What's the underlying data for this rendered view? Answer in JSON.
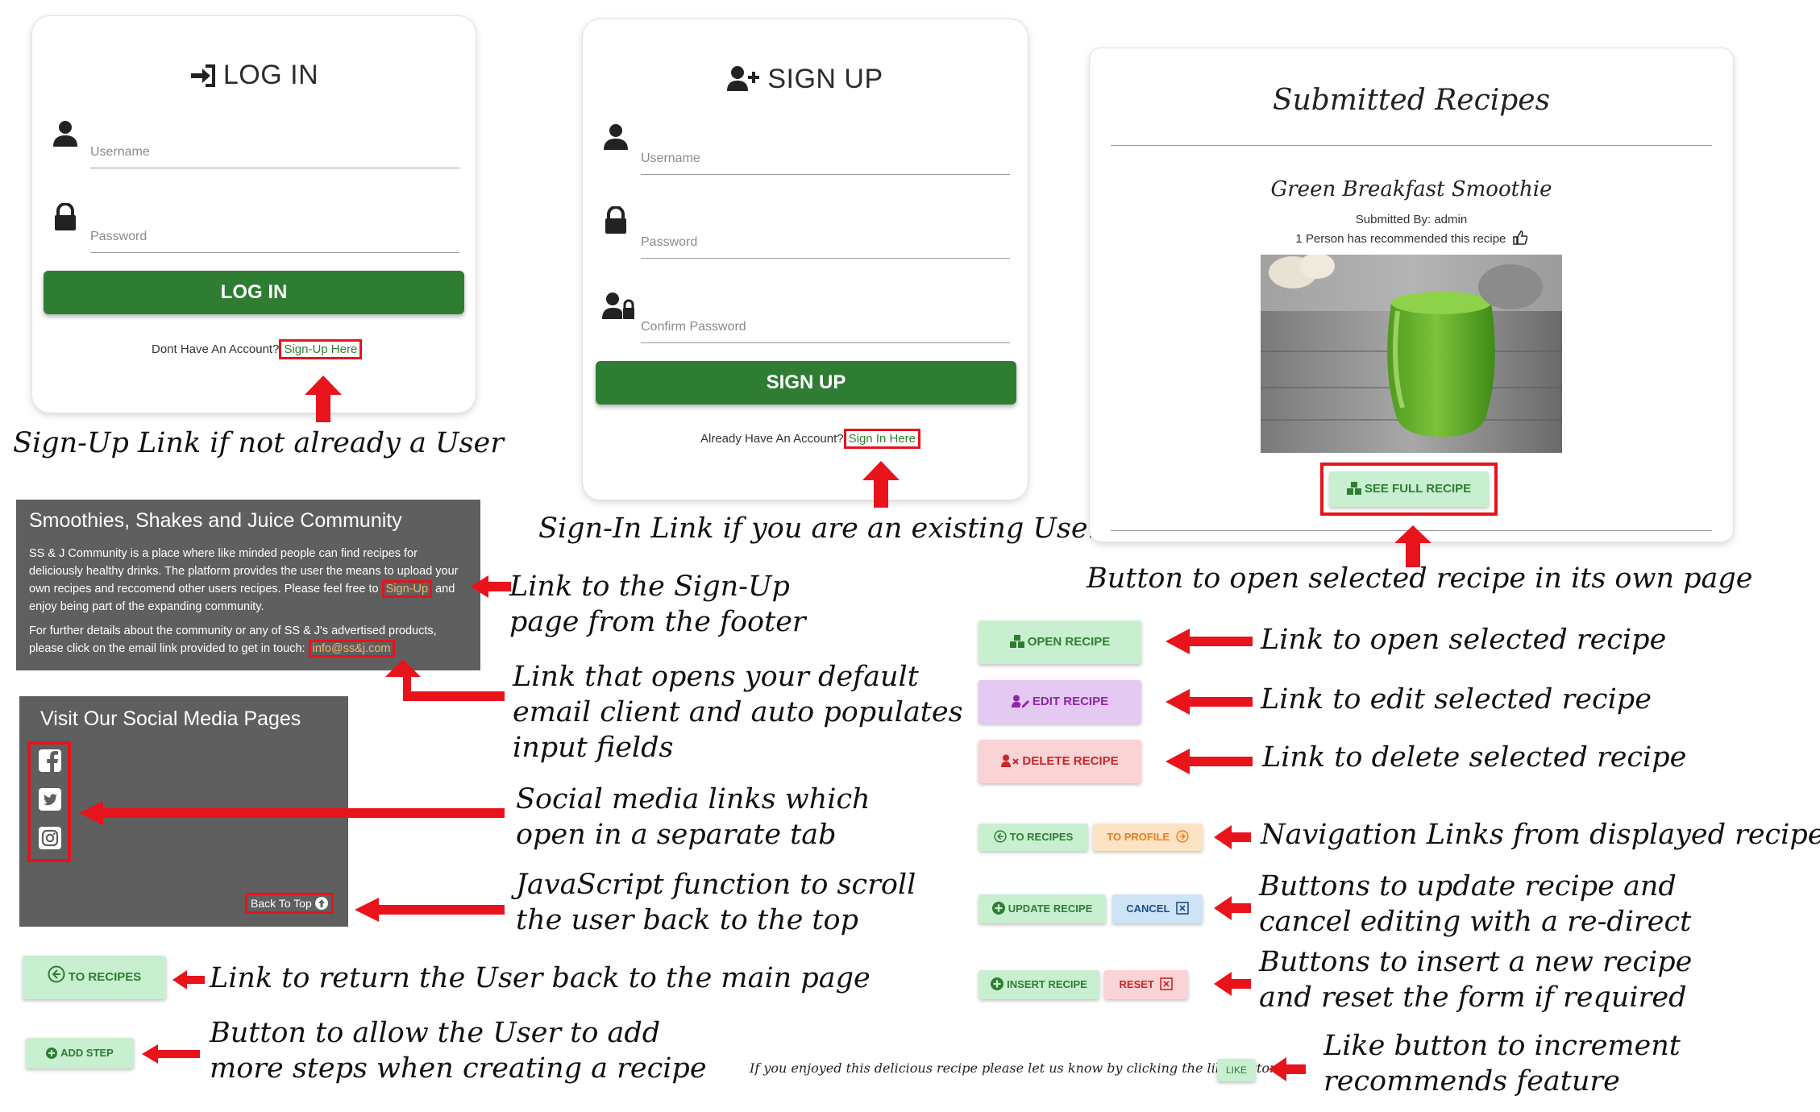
{
  "login": {
    "title": "LOG IN",
    "username_placeholder": "Username",
    "password_placeholder": "Password",
    "button": "LOG IN",
    "footer_text": "Dont Have An Account?",
    "footer_link": "Sign-Up Here"
  },
  "signup": {
    "title": "SIGN UP",
    "username_placeholder": "Username",
    "password_placeholder": "Password",
    "confirm_placeholder": "Confirm Password",
    "button": "SIGN UP",
    "footer_text": "Already Have An Account?",
    "footer_link": "Sign In Here"
  },
  "recipes": {
    "title": "Submitted Recipes",
    "recipe_name": "Green Breakfast Smoothie",
    "submitted_by": "Submitted By: admin",
    "recommended": "1 Person has recommended this recipe",
    "see_full": "SEE FULL RECIPE"
  },
  "community": {
    "title": "Smoothies, Shakes and Juice Community",
    "para1": "SS & J Community is a place where like minded people can find recipes for deliciously healthy drinks. The platform provides the user the means to upload your own recipes and reccomend other users recipes. Please feel free to",
    "para1_link": "Sign-Up",
    "para1_end": "and enjoy being part of the expanding community.",
    "para2": "For further details about the community or any of SS & J's advertised products, please click on the email link provided to get in touch:",
    "email": "info@ss&j.com"
  },
  "social": {
    "title": "Visit Our Social Media Pages",
    "back_to_top": "Back To Top"
  },
  "buttons": {
    "to_recipes": "TO RECIPES",
    "add_step": "ADD STEP",
    "open_recipe": "OPEN RECIPE",
    "edit_recipe": "EDIT RECIPE",
    "delete_recipe": "DELETE RECIPE",
    "nav_to_recipes": "TO RECIPES",
    "nav_to_profile": "TO PROFILE",
    "update_recipe": "UPDATE RECIPE",
    "cancel": "CANCEL",
    "insert_recipe": "INSERT RECIPE",
    "reset": "RESET",
    "like": "LIKE",
    "like_text": "If you enjoyed this delicious recipe please let us know by clicking the like button"
  },
  "annotations": {
    "signup_link": "Sign-Up Link if not already a User",
    "signin_link": "Sign-In Link if you are an existing User",
    "see_full": "Button to open selected recipe in its own page",
    "footer_signup_1": "Link to the Sign-Up",
    "footer_signup_2": "page from the footer",
    "email_1": "Link that opens your default",
    "email_2": "email client and auto populates",
    "email_3": "input fields",
    "social_1": "Social media links which",
    "social_2": "open in a separate tab",
    "scroll_1": "JavaScript function to scroll",
    "scroll_2": "the user back to the top",
    "to_recipes": "Link to return the User back to the main page",
    "add_step_1": "Button to allow the User to add",
    "add_step_2": "more steps when creating a recipe",
    "open": "Link to open selected recipe",
    "edit": "Link to edit selected recipe",
    "delete": "Link to delete selected recipe",
    "nav": "Navigation Links from displayed recipe",
    "update_1": "Buttons to update recipe and",
    "update_2": "cancel editing with a re-direct",
    "insert_1": "Buttons to insert a new recipe",
    "insert_2": "and reset the form if required",
    "like_1": "Like button to increment",
    "like_2": "recommends feature"
  },
  "colors": {
    "primary_green": "#2e7d32",
    "light_green": "#c8efd0",
    "light_purple": "#e4c9f2",
    "light_pink": "#f9d3d6",
    "light_orange": "#fde3c3",
    "light_blue": "#cfe3f7",
    "annotation_red": "#e8131b",
    "footer_grey": "#5f5f5f"
  }
}
